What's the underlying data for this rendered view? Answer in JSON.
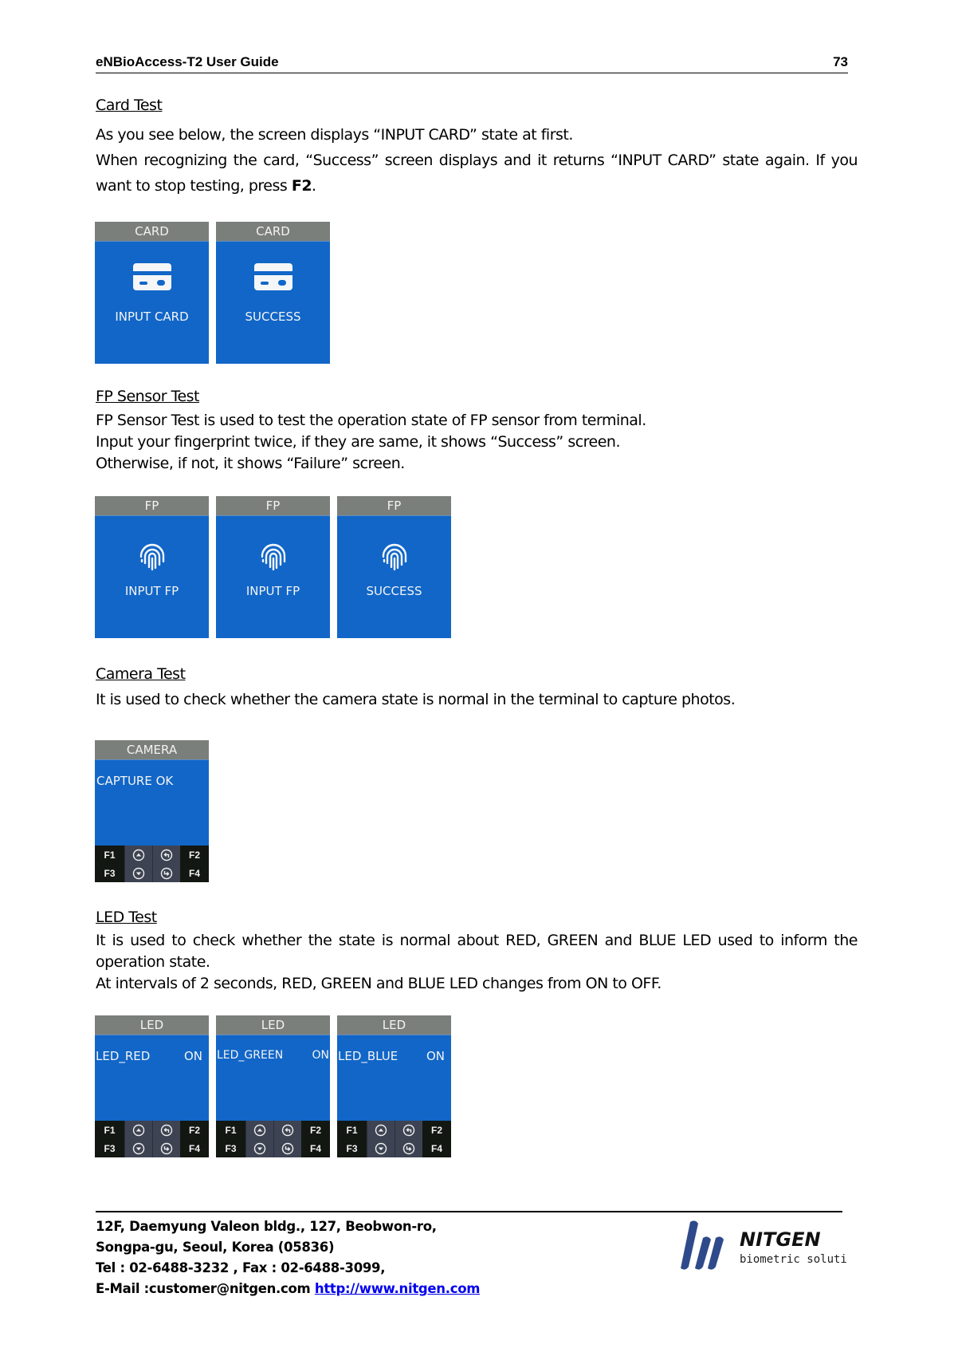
{
  "header": {
    "doc_title": "eNBioAccess-T2 User Guide",
    "page_number": "73"
  },
  "sections": {
    "card": {
      "title": "Card Test",
      "lines": [
        "As you see below, the screen displays “INPUT CARD” state at first.",
        "When recognizing the card, “Success” screen displays and it returns “INPUT CARD” state again. If you want to stop testing, press "
      ],
      "bold_key": "F2",
      "after_key": ".",
      "screens": [
        {
          "header": "CARD",
          "icon": "card-icon",
          "message": "INPUT CARD"
        },
        {
          "header": "CARD",
          "icon": "card-icon",
          "message": "SUCCESS"
        }
      ]
    },
    "fp": {
      "title": "FP Sensor Test",
      "lines": [
        "FP Sensor Test is used to test the operation state of FP sensor from terminal.",
        "Input your fingerprint twice, if they are same, it shows “Success” screen.",
        "Otherwise, if not, it shows “Failure” screen."
      ],
      "screens": [
        {
          "header": "FP",
          "icon": "fingerprint-icon",
          "message": "INPUT FP"
        },
        {
          "header": "FP",
          "icon": "fingerprint-icon",
          "message": "INPUT FP"
        },
        {
          "header": "FP",
          "icon": "fingerprint-icon",
          "message": "SUCCESS"
        }
      ]
    },
    "camera": {
      "title": "Camera Test",
      "lines": [
        "It is used to check whether the camera state is normal in the terminal to capture photos."
      ],
      "screens": [
        {
          "header": "CAMERA",
          "label": "CAPTURE OK",
          "value": ""
        }
      ]
    },
    "led": {
      "title": "LED Test",
      "lines": [
        "It is used to check whether the state is normal about RED, GREEN and BLUE LED used to inform the operation state.",
        "At intervals of 2 seconds, RED, GREEN and BLUE LED changes from ON to OFF."
      ],
      "screens": [
        {
          "header": "LED",
          "label": "LED_RED",
          "value": "ON"
        },
        {
          "header": "LED",
          "label": "LED_GREEN",
          "value": "ON"
        },
        {
          "header": "LED",
          "label": "LED_BLUE",
          "value": "ON"
        }
      ]
    }
  },
  "keypad": {
    "f1": "F1",
    "f2": "F2",
    "f3": "F3",
    "f4": "F4",
    "icons": [
      "up-arrow-icon",
      "back-arrow-icon",
      "down-arrow-icon",
      "enter-arrow-icon"
    ]
  },
  "footer": {
    "address1": "12F, Daemyung Valeon bldg., 127, Beobwon-ro,",
    "address2": "Songpa-gu, Seoul, Korea (05836)",
    "phone": "Tel : 02-6488-3232 , Fax : 02-6488-3099,",
    "email": "E-Mail :customer@nitgen.com ",
    "website": "http://www.nitgen.com",
    "logo_name": "NITGEN",
    "logo_tagline": "biometric solutions"
  },
  "colors": {
    "screen_blue": "#1166c8",
    "screen_header_gray": "#7b7f7c",
    "logo_blue": "#2f4a8a",
    "link_blue": "#0000ee"
  }
}
